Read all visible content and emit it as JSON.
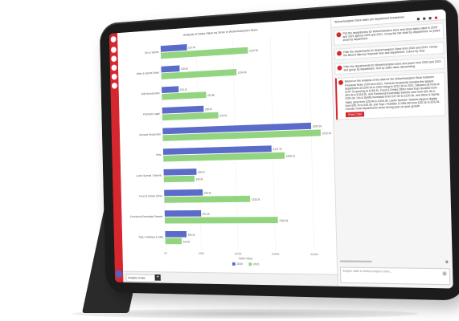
{
  "colors": {
    "accent": "#d6262e",
    "series_2020": "#5b6bc9",
    "series_2021": "#93d480"
  },
  "chart_title": "Analysis of Sales Value by Store in Wolverhampton Store",
  "chart_data": {
    "type": "bar",
    "orientation": "horizontal",
    "categories": [
      "Gin & Spirits",
      "Wine & Spirits Sales",
      "Soft Accessories",
      "Premium Lager",
      "General Household",
      "Pets",
      "Lactic Spread / Sweets",
      "Food & Drinks Other",
      "Functional Essentials Sweets",
      "Toys / Hobbies & Gifts"
    ],
    "series": [
      {
        "name": "2020",
        "values": [
          37,
          26,
          24,
          58,
          200,
          148,
          46,
          54,
          51,
          30
        ]
      },
      {
        "name": "2021",
        "values": [
          120,
          104,
          62,
          78,
          212,
          165,
          43,
          118,
          154,
          23
        ]
      }
    ],
    "xlim": [
      0,
      220
    ],
    "value_labels": {
      "2020": [
        "£37.0k",
        "£26.4k",
        "£24.1k",
        "£58.1k",
        "£200.0k",
        "£147.7k",
        "£45.7k",
        "£54.4k",
        "£51.3k",
        "£30.1k"
      ],
      "2021": [
        "£120.3k",
        "£104.0k",
        "£61.8k",
        "£78.4k",
        "£212.2k",
        "£165.1k",
        "£43.3k",
        "£118.2k",
        "£154.3k",
        "£23.2k"
      ]
    },
    "xlabel": "Sales Value",
    "legend": [
      "2020",
      "2021"
    ],
    "legend_position": "bottom-center",
    "grid": true
  },
  "tab": {
    "label": "Analysis of Sale",
    "add": "+"
  },
  "panel": {
    "header": "Wolverhampton Store sales per department breakdown",
    "messages": [
      {
        "kind": "user",
        "text": "Plot the departments for Wolverhampton store and show sales value in 2020 and 2021 split by 2020 and 2021. Group the bar chart by department, so years show by department."
      },
      {
        "kind": "user",
        "text": "Filter the departments for Wolverhampton Store from 2020 and 2021. Group the filtered data by Financial Year and department. Colour by Year."
      },
      {
        "kind": "user",
        "text": "Filter the departments for Wolverhampton store and years from 2020 and 2021 and group by department. Sort by sales value descending."
      },
      {
        "kind": "reply",
        "text": "Based on the analysis of the data for the Wolverhampton Store between Financial Years 2020 and 2021, General Household remains the largest department at £200.0k in 2020 rising to £212.2k in 2021, followed by Pets at £147.7k growing to £165.1k. Food & Drinks Other more than doubled from £54.4k to £118.2k, and Functional Essentials Sweets rose from £51.3k to £154.3k. Gin & Spirits increased from £37.0k to £120.3k, and Wine & Spirits Sales grew from £26.4k to £104.0k. Lactic Spread / Sweets dipped slightly from £45.7k to £43.3k, and Toys / Hobbies & Gifts fell from £30.1k to £23.2k. Overall, most departments show strong year-on-year growth.",
        "button": "Share Chart"
      }
    ],
    "input_placeholder": "Analyse sales in Wolverhampton Store..."
  }
}
